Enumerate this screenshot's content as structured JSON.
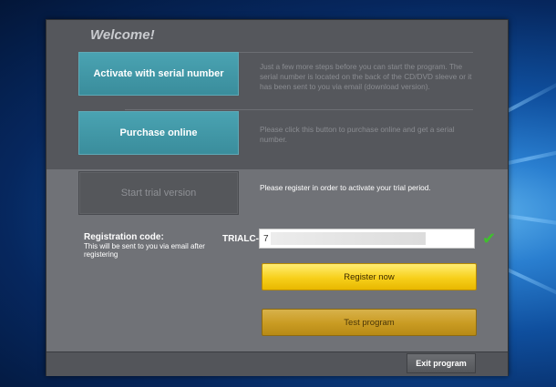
{
  "welcome": {
    "title": "Welcome!"
  },
  "activate": {
    "label": "Activate with serial number",
    "description": "Just a few more steps before you can start the program. The serial number is located on the back of the CD/DVD sleeve or it has been sent to you via email (download version)."
  },
  "purchase": {
    "label": "Purchase online",
    "description": "Please click this button to purchase online and get a serial number."
  },
  "trial": {
    "label": "Start trial version",
    "description": "Please register in order to activate your trial period."
  },
  "registration": {
    "label": "Registration code:",
    "note": "This will be sent to you via email after registering",
    "prefix": "TRIALC-",
    "value": "7"
  },
  "buttons": {
    "register": "Register now",
    "test": "Test program",
    "exit": "Exit program"
  },
  "colors": {
    "teal_button": "#4aa3b2",
    "yellow_button": "#f7cf1a",
    "check": "#3fbf2e"
  },
  "icons": {
    "valid": "check-icon"
  }
}
